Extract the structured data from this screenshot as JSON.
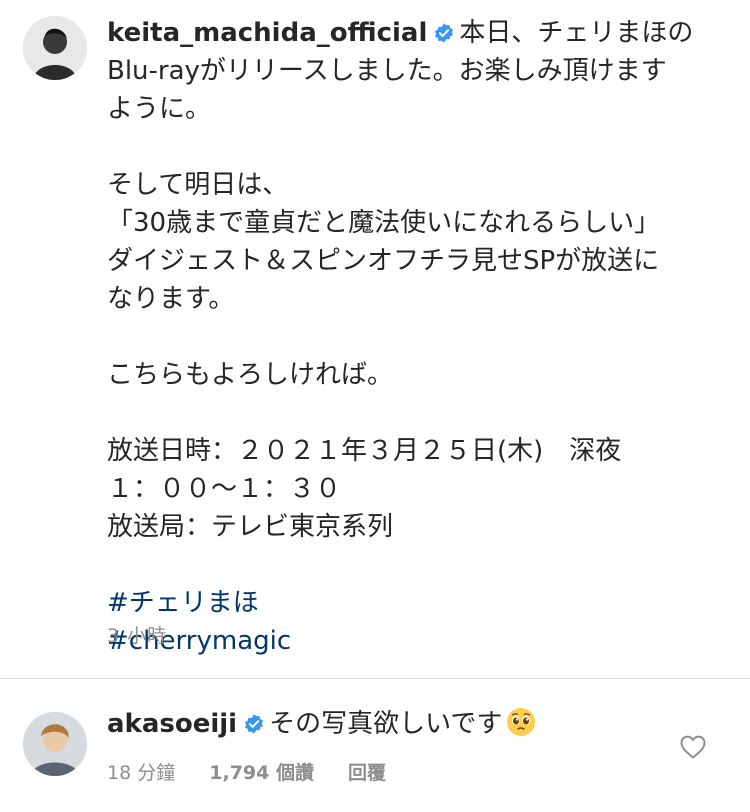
{
  "post": {
    "username": "keita_machida_official",
    "verified": true,
    "avatar_icon": "user-photo-icon",
    "caption_lines": [
      "本日、チェリまほの",
      "Blu-rayがリリースしました。お楽しみ頂けます",
      "ように。",
      "",
      "そして明日は、",
      "「30歳まで童貞だと魔法使いになれるらしい」",
      "ダイジェスト＆スピンオフチラ見せSPが放送に",
      "なります。",
      "",
      "こちらもよろしければ。",
      "",
      "放送日時：２０２１年３月２５日(木)　深夜",
      "１：００～１：３０",
      "放送局：テレビ東京系列",
      ""
    ],
    "hashtags": [
      "#チェリまほ",
      "#cherrymagic"
    ],
    "timestamp": "3 小時"
  },
  "comment": {
    "username": "akasoeiji",
    "verified": true,
    "text": "その写真欲しいです",
    "emoji": "pleading-face-emoji",
    "time": "18 分鐘",
    "likes": "1,794 個讚",
    "reply_label": "回覆",
    "like_icon": "heart-outline-icon"
  },
  "colors": {
    "text": "#262626",
    "muted": "#8e8e8e",
    "hashtag": "#00376b",
    "verified": "#3897f0",
    "divider": "#dbdbdb"
  }
}
